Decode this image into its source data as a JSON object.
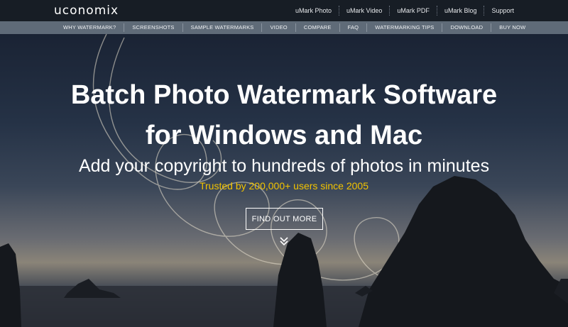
{
  "header": {
    "logo": "uconomix",
    "links": [
      "uMark Photo",
      "uMark Video",
      "uMark PDF",
      "uMark Blog",
      "Support"
    ]
  },
  "nav": {
    "items": [
      "WHY WATERMARK?",
      "SCREENSHOTS",
      "SAMPLE WATERMARKS",
      "VIDEO",
      "COMPARE",
      "FAQ",
      "WATERMARKING TIPS",
      "DOWNLOAD",
      "BUY NOW"
    ]
  },
  "hero": {
    "title_line1": "Batch Photo Watermark Software",
    "title_line2": "for Windows and Mac",
    "subtitle": "Add your copyright to hundreds of photos in minutes",
    "trust": "Trusted by 200,000+ users since 2005",
    "cta": "FIND OUT MORE",
    "scroll_icon": "double-chevron-down-icon"
  },
  "colors": {
    "topbar": "#171d25",
    "navbar": "#5f6b78",
    "accent": "#f2c300",
    "text": "#ffffff"
  }
}
